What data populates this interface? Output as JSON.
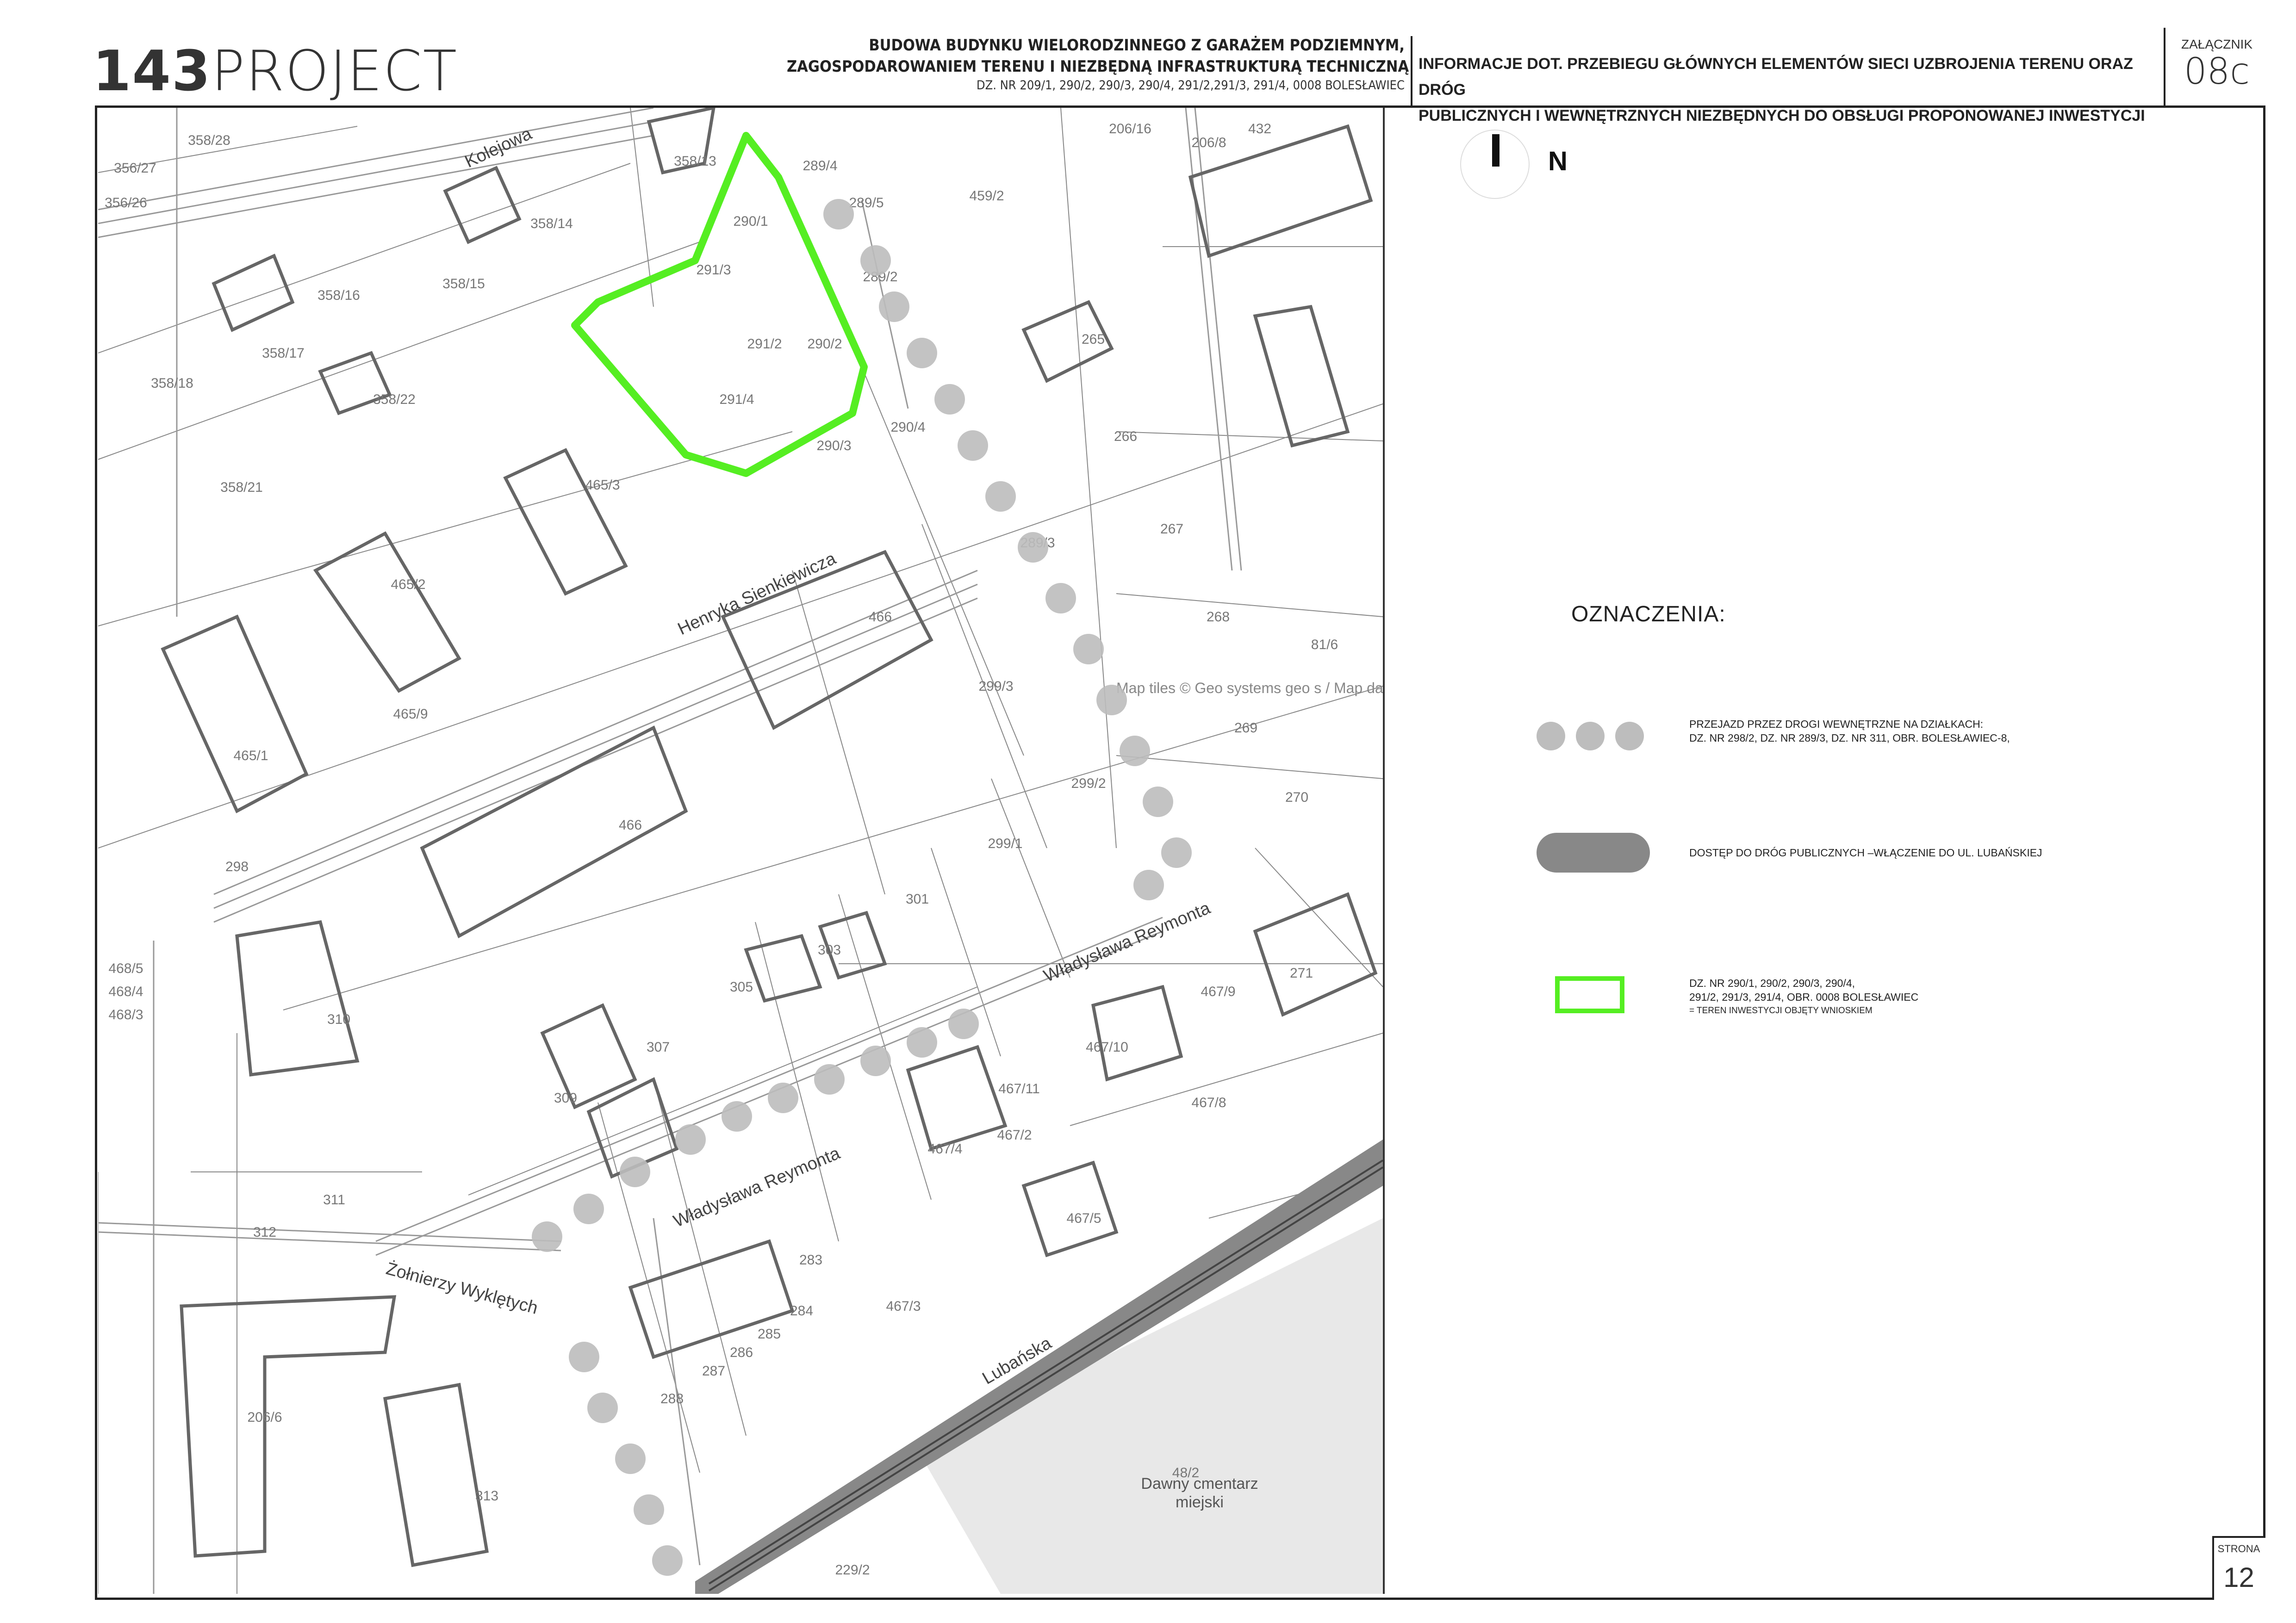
{
  "header": {
    "logo": {
      "prefix": "143",
      "suffix": "PROJECT"
    },
    "project_title_line1": "BUDOWA BUDYNKU WIELORODZINNEGO Z GARAŻEM PODZIEMNYM,",
    "project_title_line2": "ZAGOSPODAROWANIEM TERENU I NIEZBĘDNĄ INFRASTRUKTURĄ TECHNICZNĄ",
    "project_parcels": "DZ. NR 209/1, 290/2, 290/3, 290/4, 291/2,291/3, 291/4, 0008 BOLESŁAWIEC",
    "info_line1": "INFORMACJE DOT. PRZEBIEGU GŁÓWNYCH ELEMENTÓW SIECI UZBROJENIA TERENU ORAZ DRÓG",
    "info_line2": "PUBLICZNYCH I WEWNĘTRZNYCH NIEZBĘDNYCH DO OBSŁUGI PROPONOWANEJ INWESTYCJI",
    "attachment_label": "ZAŁĄCZNIK",
    "attachment_number": "08c"
  },
  "north_arrow": {
    "label": "N"
  },
  "legend": {
    "title": "OZNACZENIA:",
    "items": [
      {
        "symbol": "grey-dots",
        "line1": "PRZEJAZD PRZEZ DROGI WEWNĘTRZNE NA DZIAŁKACH:",
        "line2": "DZ. NR 298/2, DZ. NR 289/3, DZ. NR 311, OBR. BOLESŁAWIEC-8,"
      },
      {
        "symbol": "grey-pill",
        "line1": "DOSTĘP DO DRÓG PUBLICZNYCH –WŁĄCZENIE DO UL. LUBAŃSKIEJ"
      },
      {
        "symbol": "green-rectangle",
        "line1": "DZ. NR 290/1, 290/2, 290/3, 290/4,",
        "line2": "291/2, 291/3, 291/4, OBR. 0008 BOLESŁAWIEC",
        "line3": "= TEREN INWESTYCJI OBJĘTY WNIOSKIEM"
      }
    ]
  },
  "footer": {
    "page_label": "STRONA",
    "page_number": "12"
  },
  "map": {
    "colors": {
      "investment_outline": "#55ee22",
      "access_road": "#888888",
      "crossing_dots": "#bdbdbd",
      "buildings": "#666666",
      "utility_lines": "#999999"
    },
    "street_labels": [
      "Henryka Sienkiewicza",
      "Władysława Reymonta",
      "Władysława Reymonta",
      "Żołnierzy Wyklętych",
      "Lubańska",
      "Kolejowa"
    ],
    "place_labels": [
      "Dawny cmentarz",
      "miejski"
    ],
    "attribution": "Map tiles © Geo systems geo s / Map data © OpenStreetMap openstreetm",
    "parcel_labels": [
      "290/1",
      "291/3",
      "290/2",
      "291/2",
      "291/4",
      "290/3",
      "290/4",
      "289/4",
      "289/5",
      "289/2",
      "289/3",
      "459/2",
      "206/16",
      "206/8",
      "432",
      "265",
      "266",
      "267",
      "268",
      "269",
      "270",
      "271",
      "81/6",
      "358/13",
      "358/14",
      "358/15",
      "358/16",
      "358/17",
      "358/18",
      "358/22",
      "358/21",
      "358/28",
      "356/27",
      "356/26",
      "465/3",
      "465/2",
      "465/1",
      "465/9",
      "466",
      "466",
      "298",
      "299/2",
      "299/1",
      "301",
      "303",
      "305",
      "307",
      "309",
      "310",
      "311",
      "312",
      "313",
      "206/6",
      "283",
      "284",
      "285",
      "286",
      "287",
      "288",
      "467/9",
      "467/10",
      "467/11",
      "467/4",
      "467/8",
      "467/5",
      "467/3",
      "467/2",
      "48/2",
      "229/2",
      "468/5",
      "468/4",
      "468/3",
      "299/3"
    ]
  }
}
